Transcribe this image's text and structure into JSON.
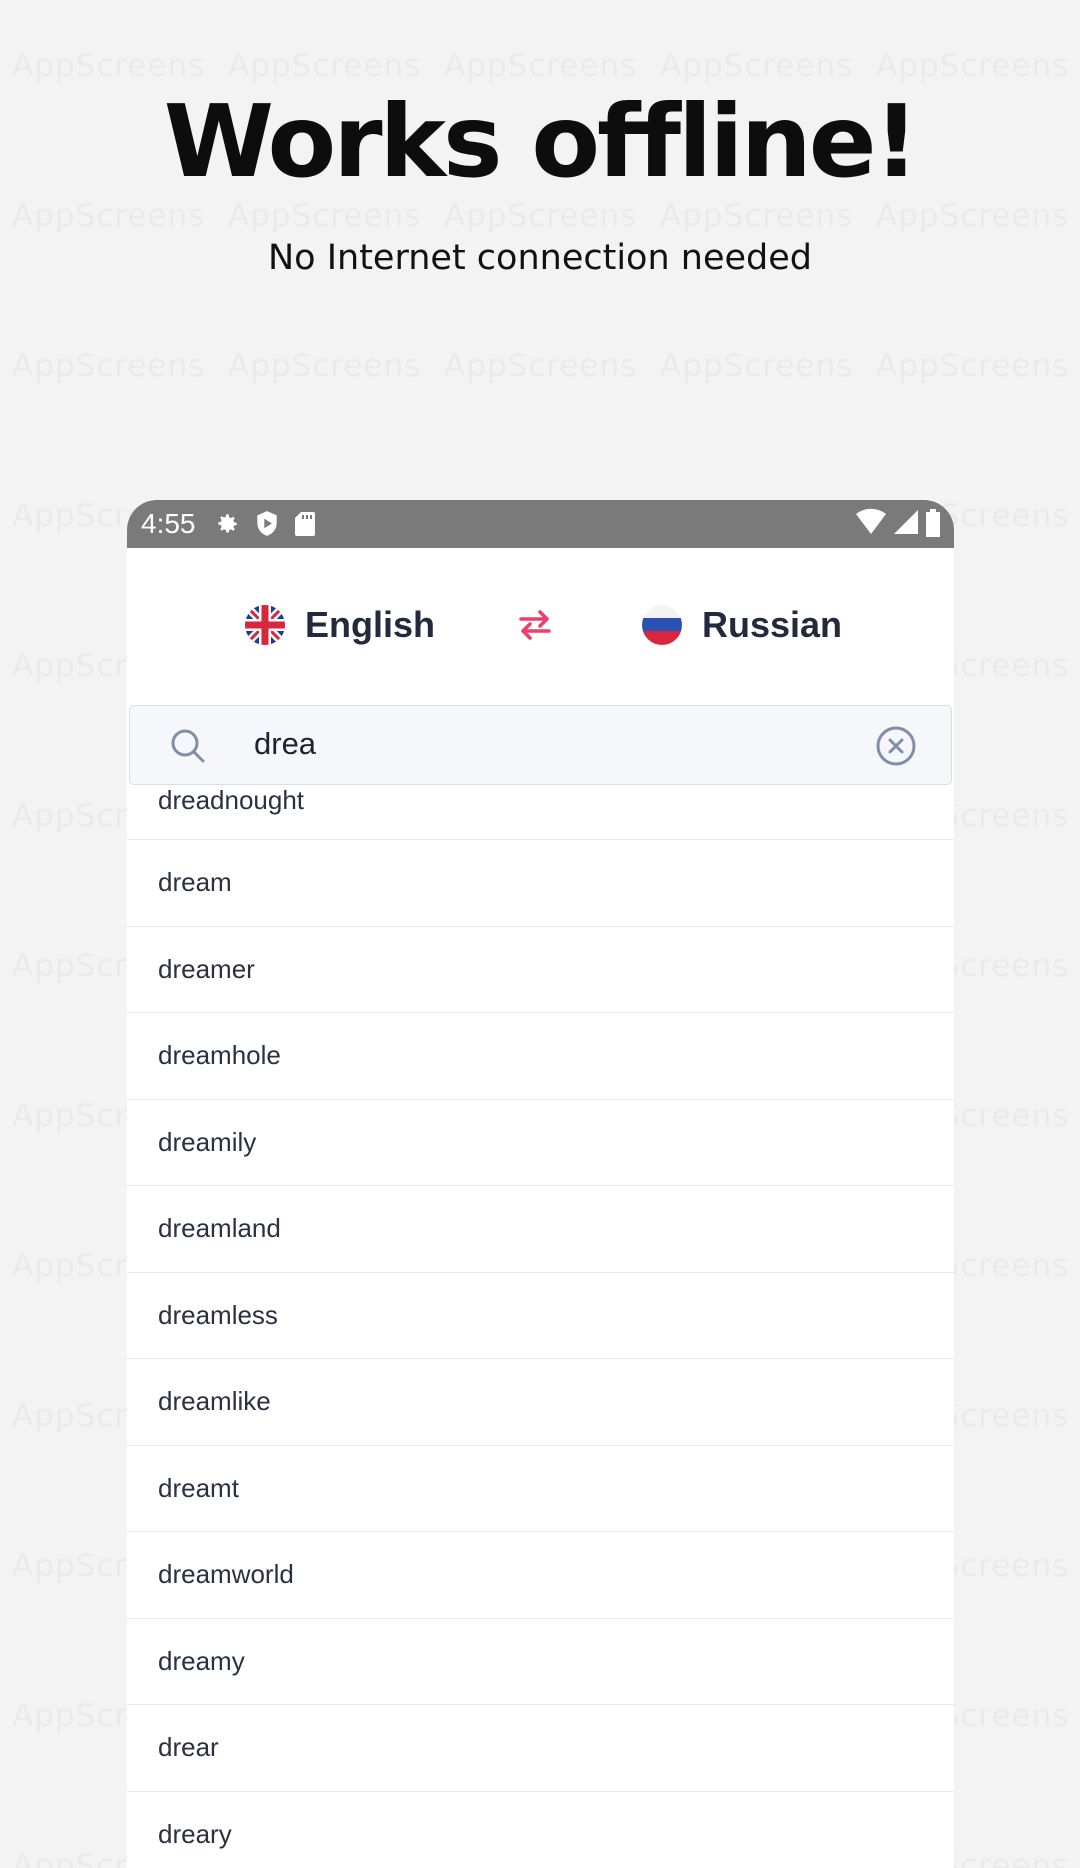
{
  "watermark": {
    "text": "AppScreens"
  },
  "headline": {
    "title": "Works offline!",
    "subtitle": "No Internet connection needed"
  },
  "statusbar": {
    "time": "4:55",
    "left_icons": [
      "gear-icon",
      "shield-play-icon",
      "sd-card-icon"
    ],
    "right_icons": [
      "wifi-icon",
      "signal-icon",
      "battery-icon"
    ]
  },
  "languages": {
    "from": {
      "name": "English",
      "flag": "uk-flag-icon"
    },
    "to": {
      "name": "Russian",
      "flag": "russia-flag-icon"
    },
    "swap_icon": "swap-arrows-icon",
    "accent_color": "#ef3d6b"
  },
  "search": {
    "value": "drea",
    "icon": "search-icon",
    "clear_icon": "clear-circle-icon"
  },
  "results": [
    "dreadnought",
    "dream",
    "dreamer",
    "dreamhole",
    "dreamily",
    "dreamland",
    "dreamless",
    "dreamlike",
    "dreamt",
    "dreamworld",
    "dreamy",
    "drear",
    "dreary"
  ]
}
